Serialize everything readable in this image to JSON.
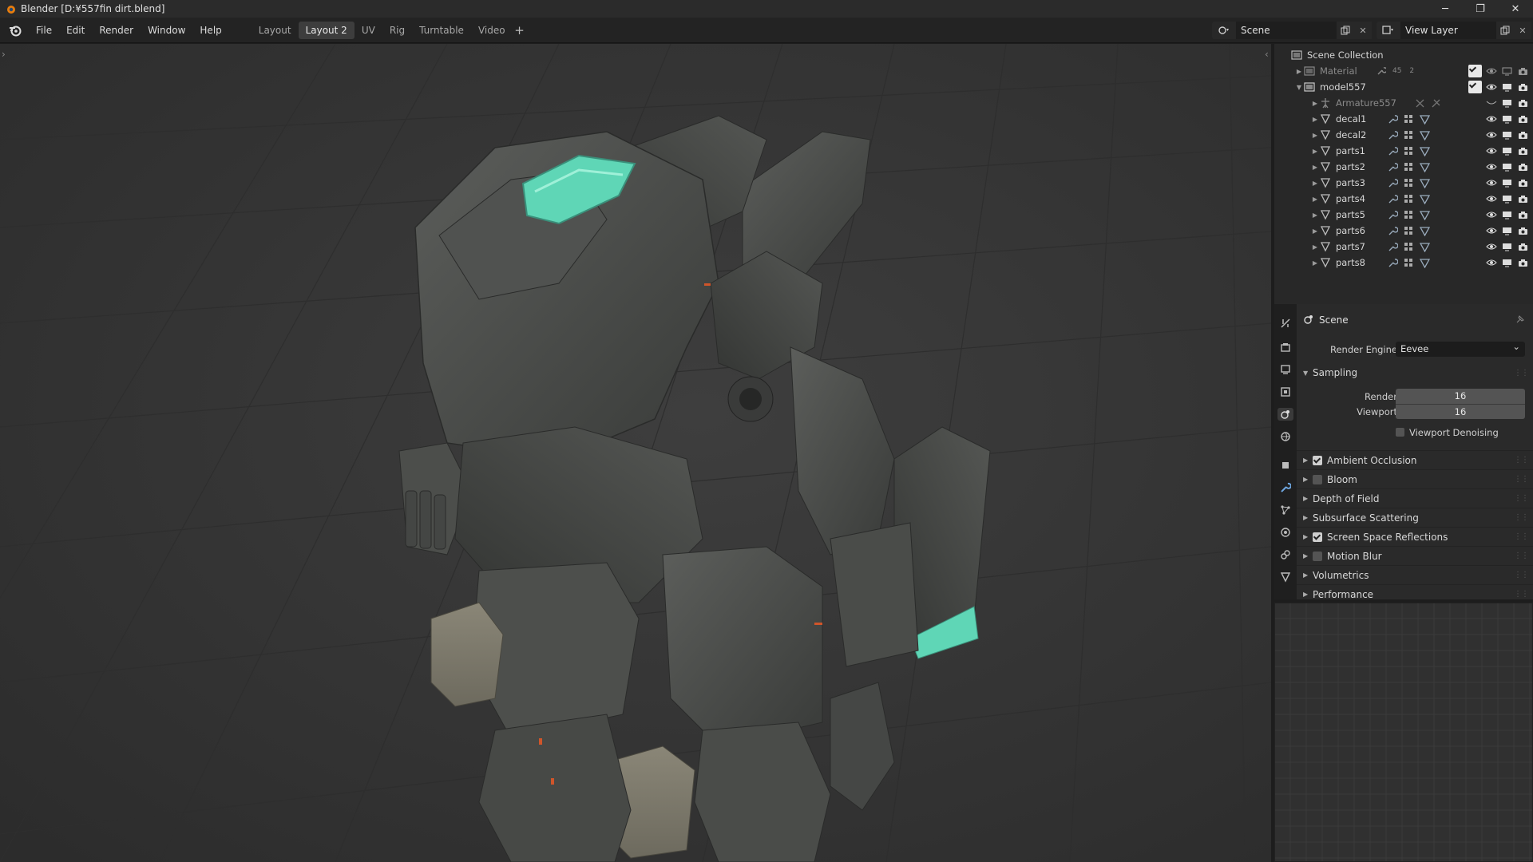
{
  "window": {
    "title": "Blender [D:¥557fin dirt.blend]",
    "minimize": "─",
    "maximize": "❐",
    "close": "✕"
  },
  "menu": {
    "items": [
      "File",
      "Edit",
      "Render",
      "Window",
      "Help"
    ]
  },
  "workspaces": {
    "tabs": [
      "Layout",
      "Layout 2",
      "UV",
      "Rig",
      "Turntable",
      "Video"
    ],
    "active": "Layout 2",
    "add": "+"
  },
  "scene_selector": {
    "value": "Scene"
  },
  "view_layer_selector": {
    "value": "View Layer"
  },
  "outliner": {
    "root": "Scene Collection",
    "rows": [
      {
        "name": "Material",
        "dim": true,
        "mod_count": "45",
        "mod_count2": "2"
      },
      {
        "name": "model557"
      },
      {
        "name": "Armature557",
        "dim": true
      },
      {
        "name": "decal1"
      },
      {
        "name": "decal2"
      },
      {
        "name": "parts1"
      },
      {
        "name": "parts2"
      },
      {
        "name": "parts3"
      },
      {
        "name": "parts4"
      },
      {
        "name": "parts5"
      },
      {
        "name": "parts6"
      },
      {
        "name": "parts7"
      },
      {
        "name": "parts8"
      }
    ]
  },
  "properties": {
    "context": "Scene",
    "render_engine_label": "Render Engine",
    "render_engine_value": "Eevee",
    "sampling": {
      "title": "Sampling",
      "render_label": "Render",
      "render_value": "16",
      "viewport_label": "Viewport",
      "viewport_value": "16",
      "denoise_label": "Viewport Denoising"
    },
    "sections": [
      {
        "label": "Ambient Occlusion",
        "checkbox": true,
        "checked": true
      },
      {
        "label": "Bloom",
        "checkbox": true,
        "checked": false
      },
      {
        "label": "Depth of Field",
        "checkbox": false
      },
      {
        "label": "Subsurface Scattering",
        "checkbox": false
      },
      {
        "label": "Screen Space Reflections",
        "checkbox": true,
        "checked": true
      },
      {
        "label": "Motion Blur",
        "checkbox": true,
        "checked": false
      },
      {
        "label": "Volumetrics",
        "checkbox": false
      },
      {
        "label": "Performance",
        "checkbox": false
      }
    ]
  },
  "colors": {
    "accent_glow": "#5fd6b6",
    "robot_body": "#4a4c49",
    "grid_line": "#2f2f2f"
  }
}
